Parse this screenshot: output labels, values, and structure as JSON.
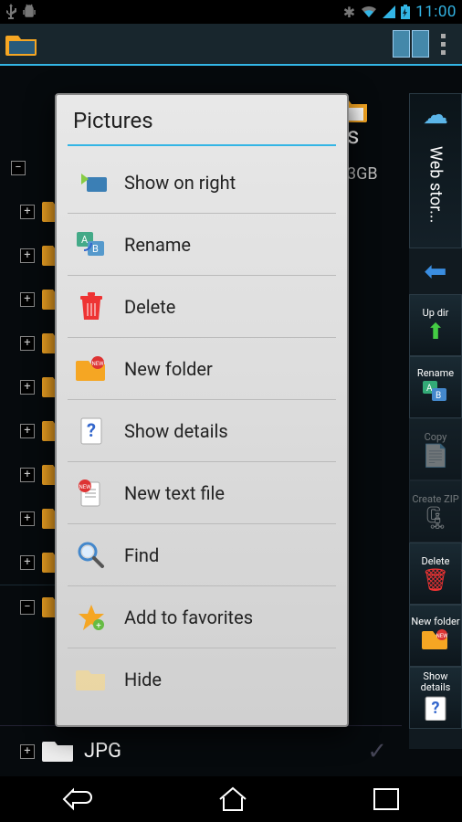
{
  "statusbar": {
    "time": "11:00"
  },
  "dialog": {
    "title": "Pictures",
    "items": [
      {
        "label": "Show on right",
        "icon": "show-right"
      },
      {
        "label": "Rename",
        "icon": "rename"
      },
      {
        "label": "Delete",
        "icon": "delete"
      },
      {
        "label": "New folder",
        "icon": "new-folder"
      },
      {
        "label": "Show details",
        "icon": "details"
      },
      {
        "label": "New text file",
        "icon": "new-text"
      },
      {
        "label": "Find",
        "icon": "find"
      },
      {
        "label": "Add to favorites",
        "icon": "favorite"
      },
      {
        "label": "Hide",
        "icon": "hide"
      }
    ]
  },
  "background": {
    "visible_label_suffix": "s",
    "storage_info": "3GB",
    "tree": {
      "bottom_item": "JPG"
    }
  },
  "sidebar": {
    "web_storage": "Web stor...",
    "buttons": [
      {
        "label": "Up dir",
        "icon": "up",
        "enabled": true
      },
      {
        "label": "Rename",
        "icon": "rename",
        "enabled": true
      },
      {
        "label": "Copy",
        "icon": "copy",
        "enabled": false
      },
      {
        "label": "Create ZIP",
        "icon": "zip",
        "enabled": false
      },
      {
        "label": "Delete",
        "icon": "delete",
        "enabled": true
      },
      {
        "label": "New folder",
        "icon": "new-folder",
        "enabled": true
      },
      {
        "label": "Show details",
        "icon": "details",
        "enabled": true
      }
    ]
  }
}
